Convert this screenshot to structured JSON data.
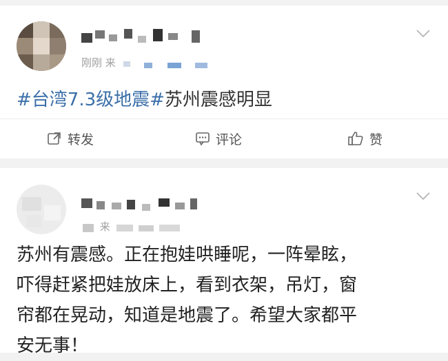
{
  "posts": [
    {
      "meta_prefix": "刚刚 来",
      "text_tag": "#台湾7.3级地震#",
      "text_body": "苏州震感明显",
      "actions": {
        "repost": "转发",
        "comment": "评论",
        "like": "赞"
      }
    },
    {
      "meta_prefix": "来",
      "lines": [
        "苏州有震感。正在抱娃哄睡呢，一阵晕眩，",
        "吓得赶紧把娃放床上，看到衣架，吊灯，窗",
        "帘都在晃动，知道是地震了。希望大家都平",
        "安无事！"
      ]
    }
  ],
  "colors": {
    "hashtag": "#3b6fa8",
    "meta": "#a0a0a0",
    "background": "#f2f2f2"
  },
  "icons": [
    "chevron-down-icon",
    "repost-icon",
    "comment-icon",
    "like-icon"
  ]
}
